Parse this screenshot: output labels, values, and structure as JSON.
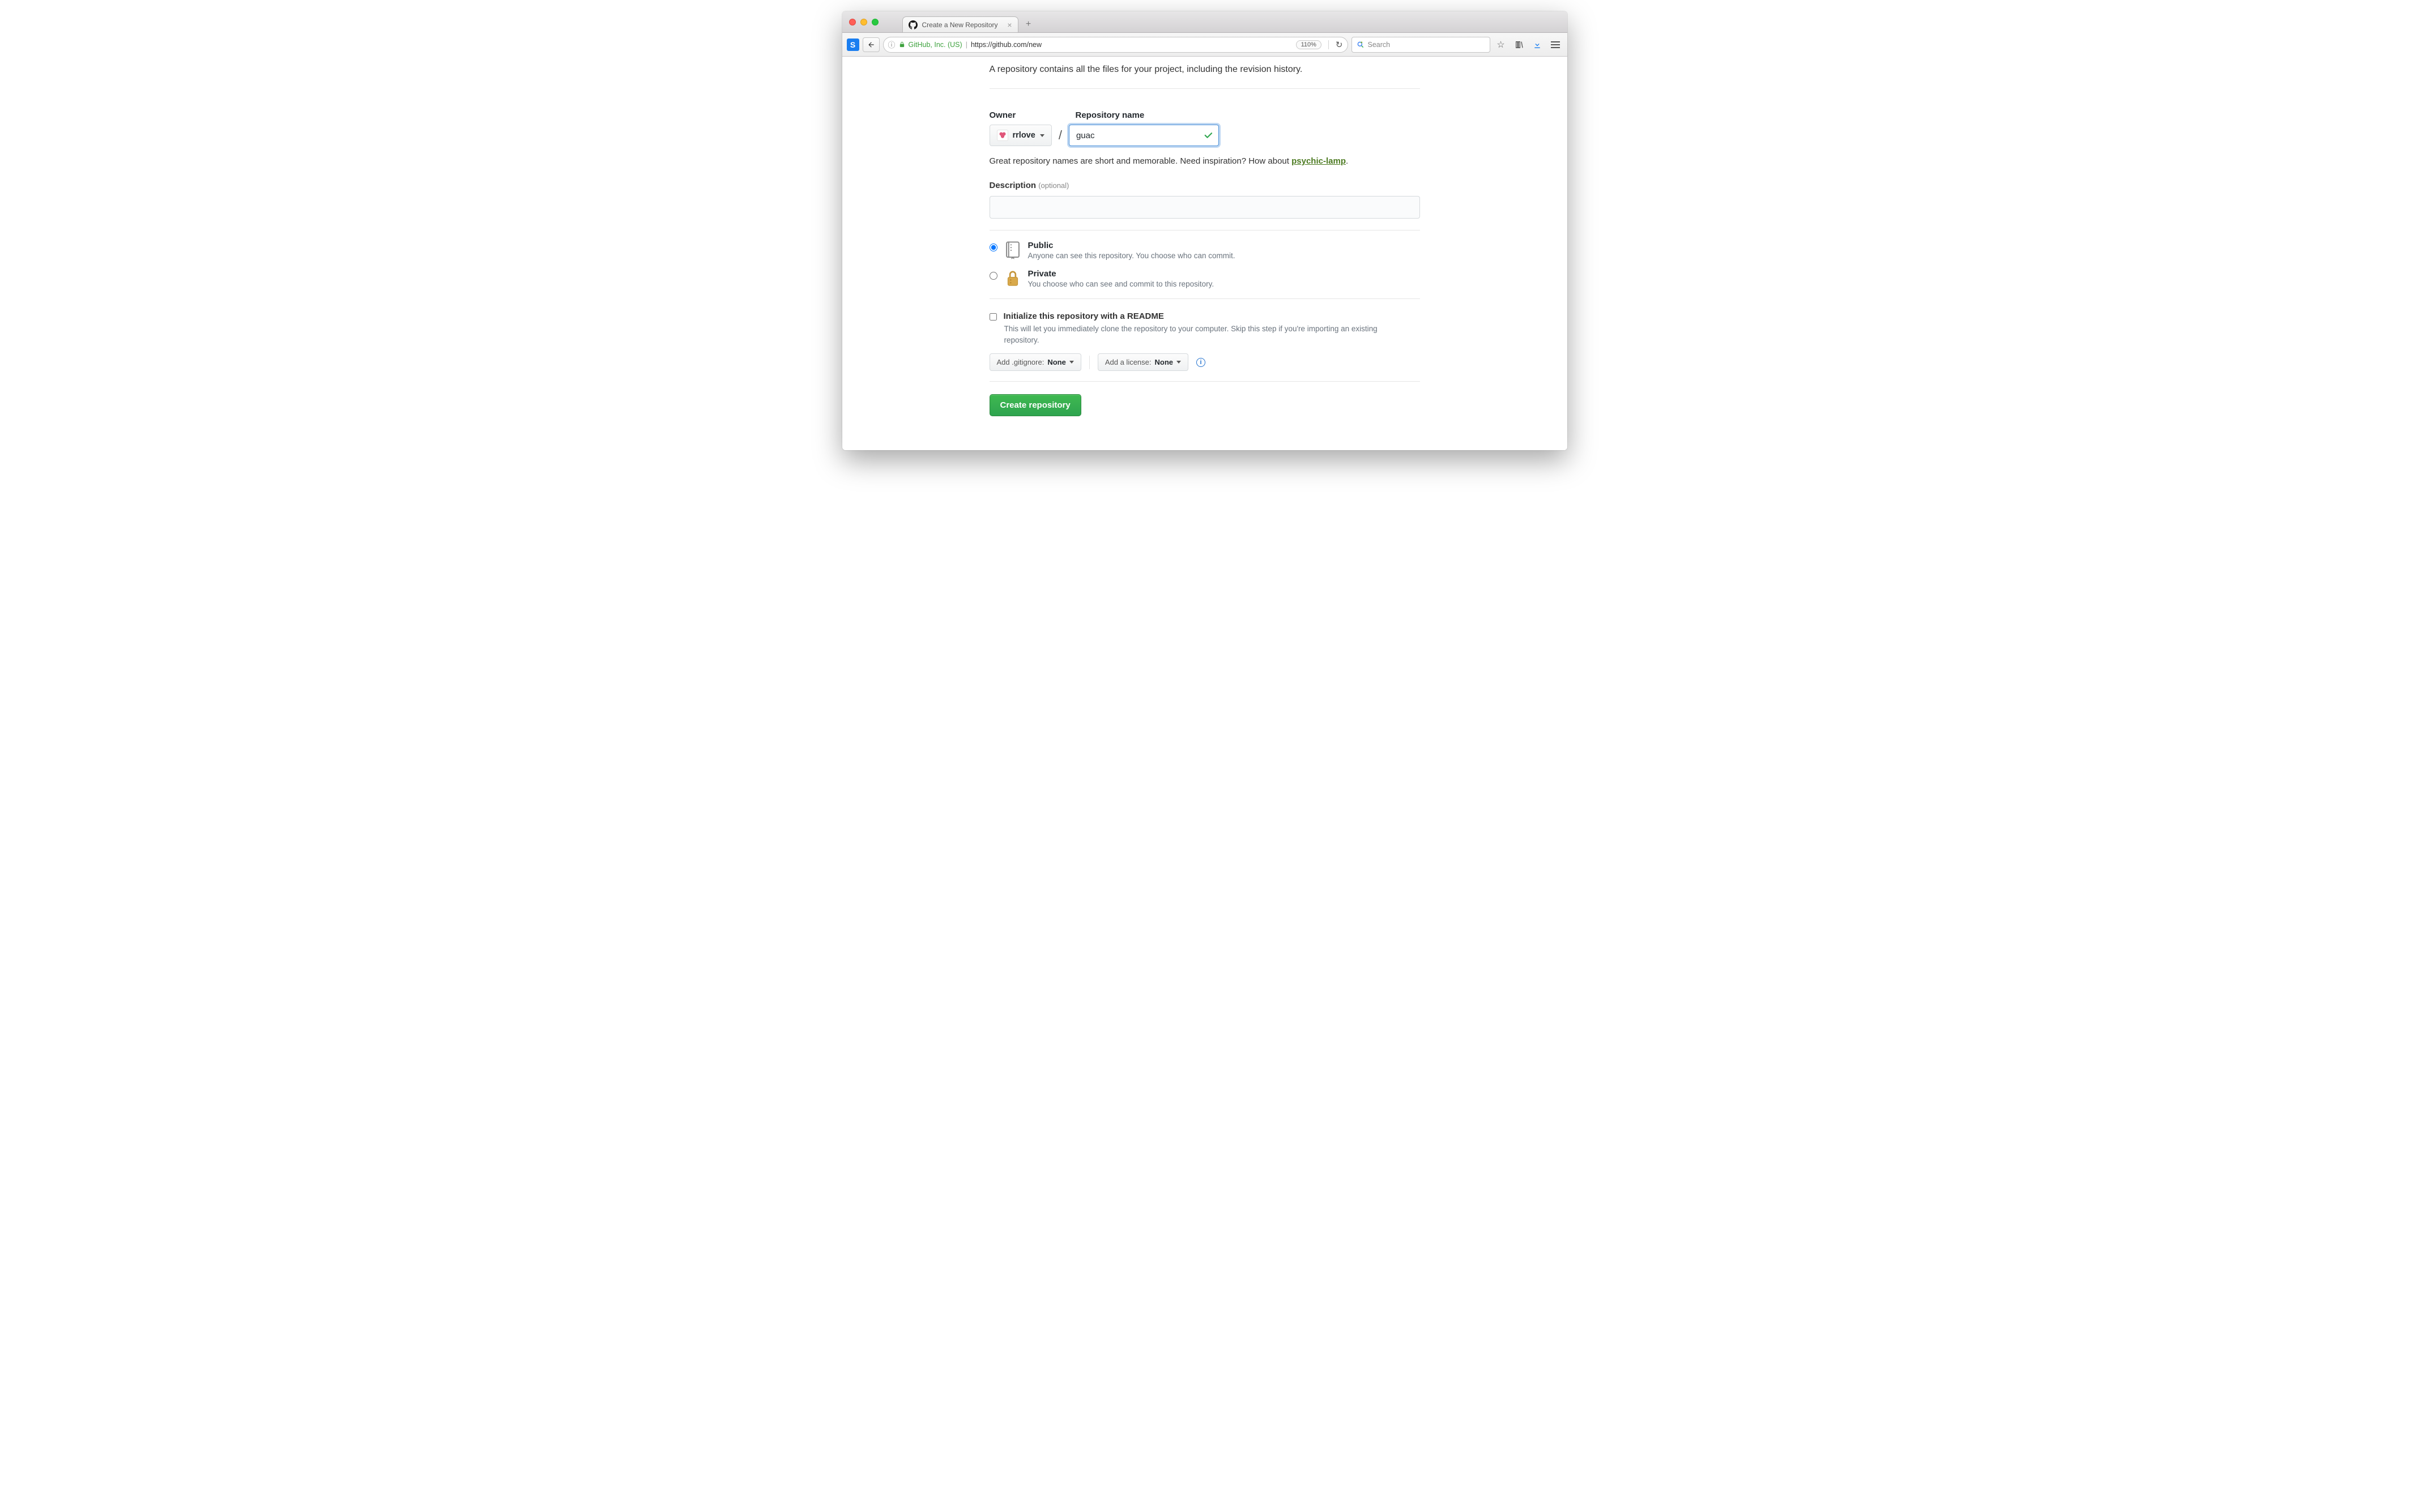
{
  "browser": {
    "tab_title": "Create a New Repository",
    "url_org": "GitHub, Inc. (US)",
    "url_path": "https://github.com/new",
    "zoom": "110%",
    "search_placeholder": "Search",
    "ext_badge": "S"
  },
  "page": {
    "intro": "A repository contains all the files for your project, including the revision history.",
    "owner_label": "Owner",
    "repo_name_label": "Repository name",
    "owner_value": "rrlove",
    "repo_name_value": "guac",
    "name_hint_prefix": "Great repository names are short and memorable. Need inspiration? How about ",
    "name_hint_suggestion": "psychic-lamp",
    "name_hint_suffix": ".",
    "desc_label": "Description",
    "desc_optional": "(optional)",
    "desc_value": "",
    "visibility": {
      "public": {
        "title": "Public",
        "sub": "Anyone can see this repository. You choose who can commit."
      },
      "private": {
        "title": "Private",
        "sub": "You choose who can see and commit to this repository."
      }
    },
    "init": {
      "title": "Initialize this repository with a README",
      "sub": "This will let you immediately clone the repository to your computer. Skip this step if you're importing an existing repository."
    },
    "gitignore": {
      "label": "Add .gitignore: ",
      "value": "None"
    },
    "license": {
      "label": "Add a license: ",
      "value": "None"
    },
    "submit": "Create repository"
  }
}
